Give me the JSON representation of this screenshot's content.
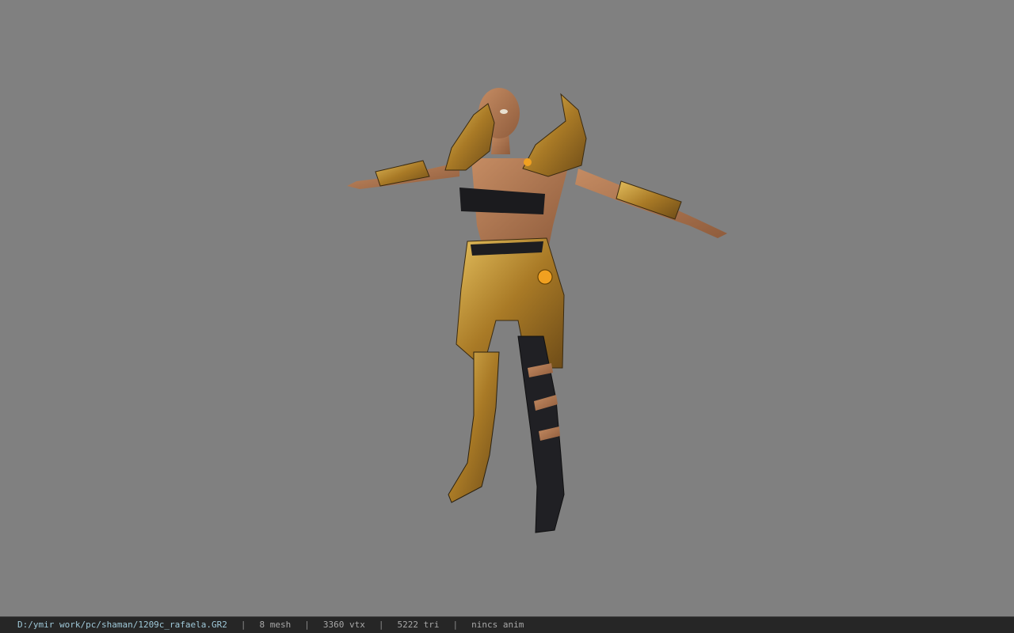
{
  "viewer": {
    "background_color": "#808080",
    "model_name": "1209c_rafaela"
  },
  "status_bar": {
    "file_path": "D:/ymir work/pc/shaman/1209c_rafaela.GR2",
    "separator": "|",
    "mesh_count": "8 mesh",
    "vertex_count": "3360 vtx",
    "triangle_count": "5222 tri",
    "animation": "nincs anim"
  },
  "colors": {
    "skin": "#b07a55",
    "gold": "#b8892e",
    "dark_cloth": "#1c1c1f",
    "gem": "#f0a020"
  }
}
